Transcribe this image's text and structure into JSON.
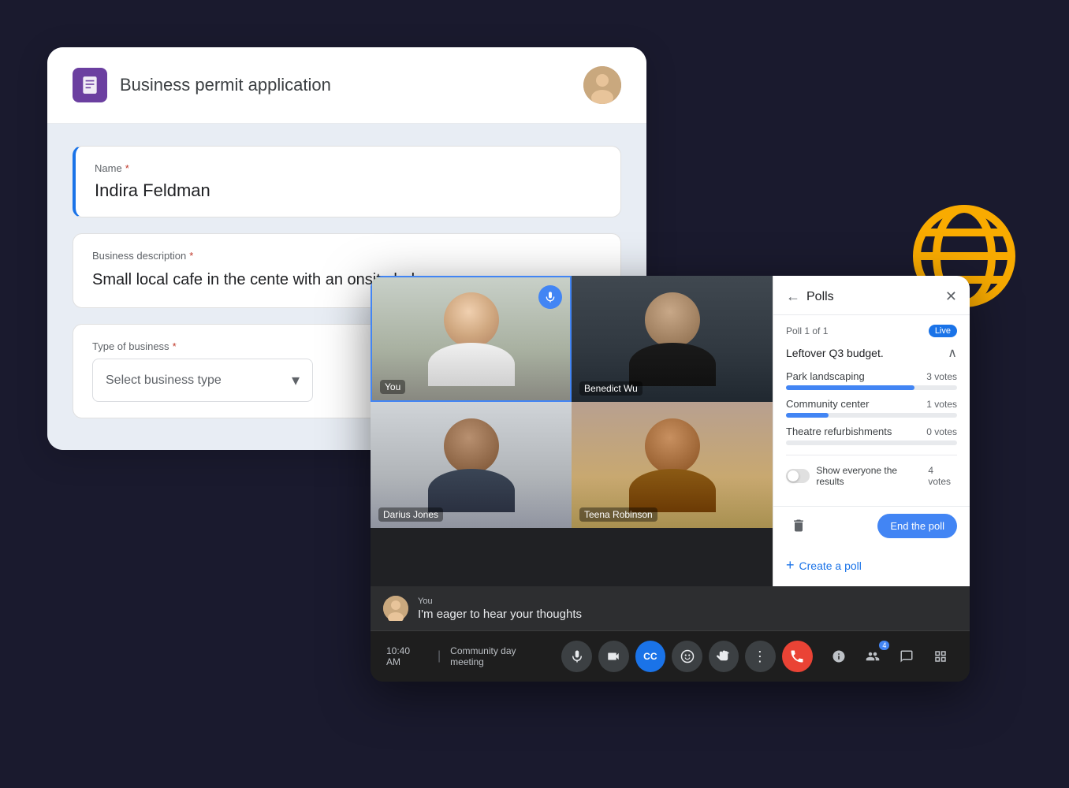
{
  "background": "#1a1a2e",
  "form": {
    "title": "Business permit application",
    "doc_icon": "📋",
    "fields": {
      "name": {
        "label": "Name",
        "required": true,
        "value": "Indira Feldman"
      },
      "business_description": {
        "label": "Business description",
        "required": true,
        "value": "Small local cafe in the cente with an onsite bakery."
      },
      "type_of_business": {
        "label": "Type of business",
        "required": true,
        "placeholder": "Select business type",
        "chevron": "▾"
      }
    }
  },
  "video_call": {
    "time": "10:40 AM",
    "separator": "|",
    "meeting_name": "Community day meeting",
    "participants": {
      "you": {
        "label": "You"
      },
      "benedict": {
        "label": "Benedict Wu"
      },
      "darius": {
        "label": "Darius Jones"
      },
      "teena": {
        "label": "Teena Robinson"
      }
    },
    "chat": {
      "sender": "You",
      "message": "I'm eager to hear your thoughts"
    },
    "toolbar": {
      "mic_icon": "🎤",
      "camera_icon": "📷",
      "cc_icon": "CC",
      "emoji_icon": "😊",
      "hand_icon": "✋",
      "more_icon": "⋮",
      "end_call_icon": "📵",
      "info_icon": "ⓘ",
      "participants_icon": "👥",
      "participants_count": "4",
      "chat_icon": "💬",
      "grid_icon": "⊞"
    }
  },
  "polls": {
    "title": "Polls",
    "back_icon": "←",
    "close_icon": "✕",
    "poll_counter": "Poll 1 of 1",
    "live_label": "Live",
    "question": "Leftover Q3 budget.",
    "collapse_icon": "∧",
    "options": [
      {
        "label": "Park landscaping",
        "votes": "3 votes",
        "percent": 75
      },
      {
        "label": "Community center",
        "votes": "1 votes",
        "percent": 25
      },
      {
        "label": "Theatre refurbishments",
        "votes": "0 votes",
        "percent": 0
      }
    ],
    "show_results_label": "Show everyone the results",
    "show_results_votes": "4 votes",
    "delete_icon": "🗑",
    "end_poll_label": "End the poll",
    "create_poll_label": "Create a poll",
    "create_plus": "+"
  },
  "globe": {
    "color": "#F9AB00",
    "size": 130
  }
}
